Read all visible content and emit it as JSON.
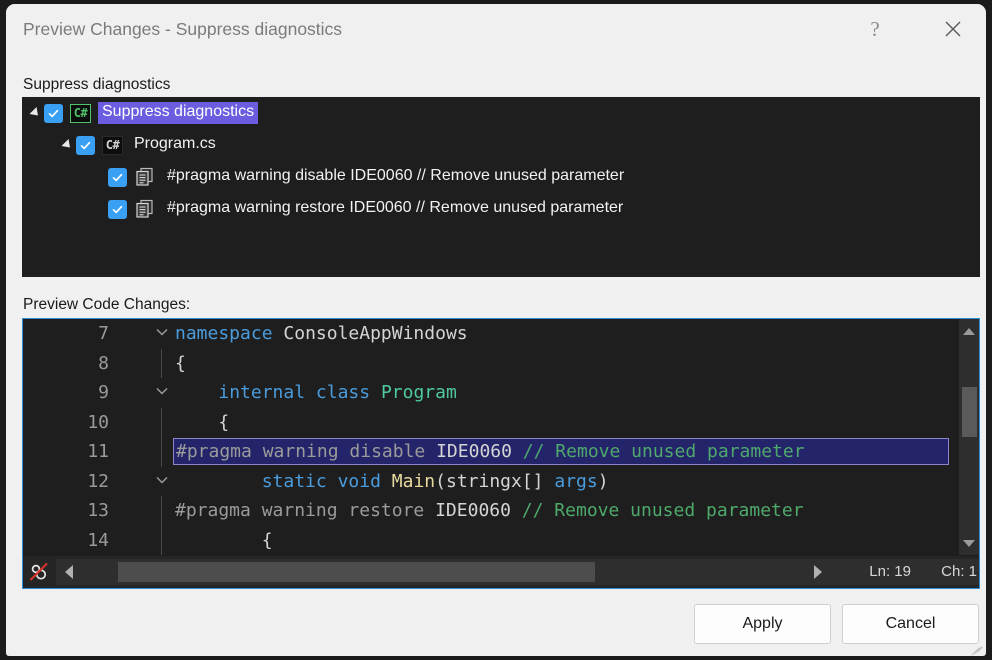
{
  "window": {
    "title": "Preview Changes - Suppress diagnostics",
    "help_glyph": "?",
    "help_name": "help-button",
    "close_name": "close-button"
  },
  "tree_section": {
    "label": "Suppress diagnostics",
    "rows": [
      {
        "text": "Suppress diagnostics",
        "icon": "csharp-icon",
        "icon_text": "C#",
        "indent": 0,
        "expander": true,
        "checked": true,
        "selected": true
      },
      {
        "text": "Program.cs",
        "icon": "csharp-icon",
        "icon_text": "C#",
        "indent": 1,
        "expander": true,
        "checked": true,
        "selected": false
      },
      {
        "text": "#pragma warning disable IDE0060 // Remove unused parameter",
        "icon": "code-change-icon",
        "icon_text": "",
        "indent": 2,
        "expander": false,
        "checked": true,
        "selected": false
      },
      {
        "text": "#pragma warning restore IDE0060 // Remove unused parameter",
        "icon": "code-change-icon",
        "icon_text": "",
        "indent": 2,
        "expander": false,
        "checked": true,
        "selected": false
      }
    ]
  },
  "code_section": {
    "label": "Preview Code Changes:",
    "lines": [
      {
        "num": "7",
        "fold": "v",
        "guide": false,
        "selected": false,
        "indent": 0,
        "spans": [
          {
            "t": "namespace",
            "c": "kw"
          },
          {
            "t": " ",
            "c": "plain"
          },
          {
            "t": "ConsoleAppWindows",
            "c": "plain"
          }
        ]
      },
      {
        "num": "8",
        "fold": "",
        "guide": true,
        "selected": false,
        "indent": 1,
        "spans": [
          {
            "t": "{",
            "c": "plain"
          }
        ]
      },
      {
        "num": "9",
        "fold": "v",
        "guide": false,
        "selected": false,
        "indent": 1,
        "spans": [
          {
            "t": "    ",
            "c": "plain"
          },
          {
            "t": "internal",
            "c": "kw"
          },
          {
            "t": " ",
            "c": "plain"
          },
          {
            "t": "class",
            "c": "kw"
          },
          {
            "t": " ",
            "c": "plain"
          },
          {
            "t": "Program",
            "c": "type"
          }
        ]
      },
      {
        "num": "10",
        "fold": "",
        "guide": true,
        "selected": false,
        "indent": 1,
        "spans": [
          {
            "t": "    ",
            "c": "plain"
          },
          {
            "t": "{",
            "c": "plain"
          }
        ]
      },
      {
        "num": "11",
        "fold": "",
        "guide": true,
        "selected": true,
        "indent": 0,
        "spans": [
          {
            "t": "#pragma warning disable ",
            "c": "ppd"
          },
          {
            "t": "IDE0060 ",
            "c": "ppc"
          },
          {
            "t": "// Remove unused parameter",
            "c": "cmt"
          }
        ]
      },
      {
        "num": "12",
        "fold": "v",
        "guide": false,
        "selected": false,
        "indent": 0,
        "spans": [
          {
            "t": "        ",
            "c": "plain"
          },
          {
            "t": "static",
            "c": "kw"
          },
          {
            "t": " ",
            "c": "plain"
          },
          {
            "t": "void",
            "c": "kw"
          },
          {
            "t": " ",
            "c": "plain"
          },
          {
            "t": "Main",
            "c": "meth"
          },
          {
            "t": "(",
            "c": "plain"
          },
          {
            "t": "stringx[] ",
            "c": "plain"
          },
          {
            "t": "args",
            "c": "kw"
          },
          {
            "t": ")",
            "c": "plain"
          }
        ]
      },
      {
        "num": "13",
        "fold": "",
        "guide": true,
        "selected": false,
        "indent": 0,
        "spans": [
          {
            "t": "#pragma warning restore ",
            "c": "ppd"
          },
          {
            "t": "IDE0060 ",
            "c": "ppc"
          },
          {
            "t": "// Remove unused parameter",
            "c": "cmt"
          }
        ]
      },
      {
        "num": "14",
        "fold": "",
        "guide": true,
        "selected": false,
        "indent": 1,
        "spans": [
          {
            "t": "        ",
            "c": "plain"
          },
          {
            "t": "{",
            "c": "plain"
          }
        ]
      }
    ],
    "status": {
      "line": "Ln: 19",
      "column": "Ch: 1",
      "codelens_icon": "codelens-disabled-icon"
    }
  },
  "footer": {
    "apply_label": "Apply",
    "cancel_label": "Cancel"
  },
  "colors": {
    "selection_purple": "#6b5ce0",
    "checkbox_blue": "#3aa0f3",
    "editor_border_blue": "#2a8fd6",
    "csharp_green": "#4fc46b",
    "comment_green": "#4ea96b",
    "keyword_blue": "#4a9cdc",
    "type_teal": "#4ec9a0",
    "method_yellow": "#e8d9a0",
    "editor_bg": "#1e1e1e",
    "dialog_bg": "#f0f0f0"
  }
}
